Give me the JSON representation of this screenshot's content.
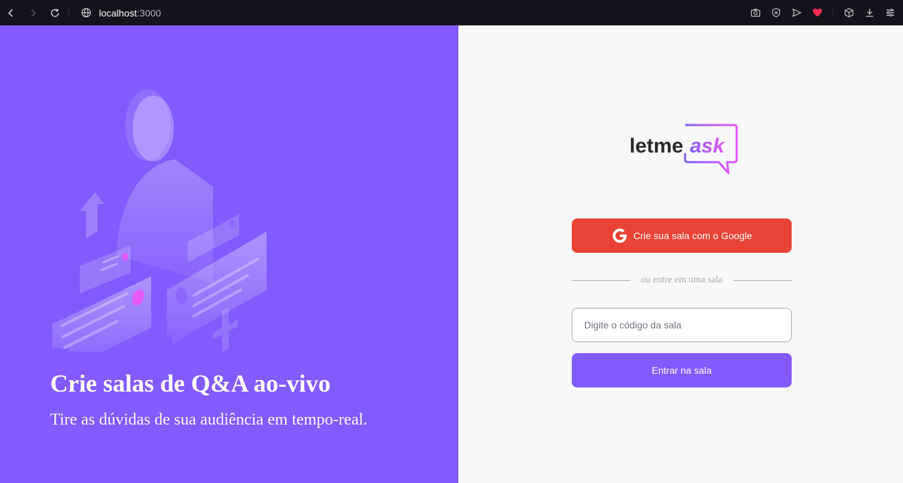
{
  "browser": {
    "url_host": "localhost",
    "url_port": ":3000"
  },
  "aside": {
    "title": "Crie salas de Q&A ao-vivo",
    "subtitle": "Tire as dúvidas de sua audiência em tempo-real."
  },
  "logo": {
    "text_letme": "letme",
    "text_ask": "ask"
  },
  "auth": {
    "google_button_label": "Crie sua sala com o Google",
    "separator_text": "ou entre em uma sala",
    "room_input_placeholder": "Digite o código da sala",
    "room_input_value": "",
    "enter_button_label": "Entrar na sala"
  },
  "colors": {
    "primary": "#835afd",
    "google": "#ea4335",
    "background": "#f8f8f8",
    "logo_gradient_start": "#835afd",
    "logo_gradient_end": "#e559f9"
  }
}
